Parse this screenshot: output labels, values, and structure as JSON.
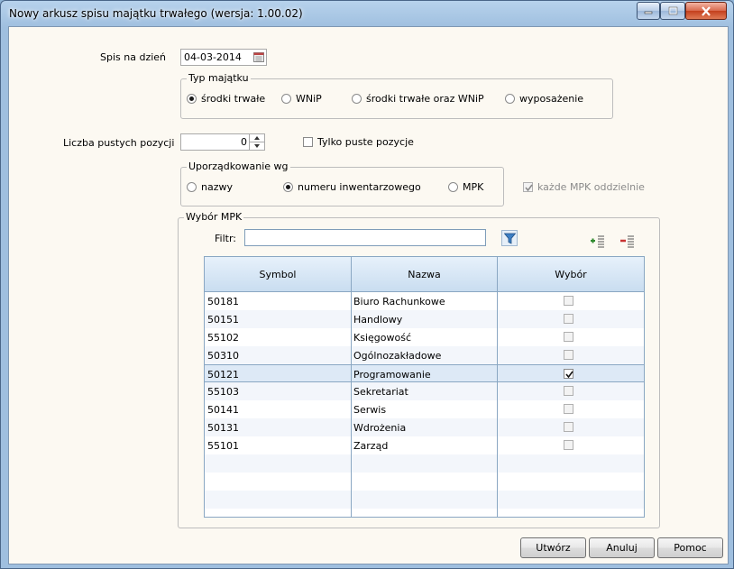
{
  "window": {
    "title": "Nowy arkusz spisu majątku trwałego (wersja: 1.00.02)",
    "controls": [
      "minimize-icon",
      "maximize-icon",
      "close-icon"
    ]
  },
  "form": {
    "date_label": "Spis na dzień",
    "date_value": "04-03-2014",
    "asset_type": {
      "legend": "Typ majątku",
      "options": [
        "środki trwałe",
        "WNiP",
        "środki trwałe oraz WNiP",
        "wyposażenie"
      ],
      "selected": "środki trwałe"
    },
    "empty_count_label": "Liczba pustych pozycji",
    "empty_count_value": "0",
    "only_empty_label": "Tylko puste pozycje",
    "only_empty_checked": false,
    "ordering": {
      "legend": "Uporządkowanie wg",
      "options": [
        "nazwy",
        "numeru inwentarzowego",
        "MPK"
      ],
      "selected": "numeru inwentarzowego"
    },
    "each_mpk_label": "każde MPK oddzielnie",
    "each_mpk_checked": true,
    "each_mpk_enabled": false
  },
  "mpk": {
    "legend": "Wybór MPK",
    "filter_label": "Filtr:",
    "filter_value": "",
    "columns": [
      "Symbol",
      "Nazwa",
      "Wybór"
    ],
    "rows": [
      {
        "symbol": "50181",
        "name": "Biuro Rachunkowe",
        "selected": false
      },
      {
        "symbol": "50151",
        "name": "Handlowy",
        "selected": false
      },
      {
        "symbol": "55102",
        "name": "Księgowość",
        "selected": false
      },
      {
        "symbol": "50310",
        "name": "Ogólnozakładowe",
        "selected": false
      },
      {
        "symbol": "50121",
        "name": "Programowanie",
        "selected": true
      },
      {
        "symbol": "55103",
        "name": "Sekretariat",
        "selected": false
      },
      {
        "symbol": "50141",
        "name": "Serwis",
        "selected": false
      },
      {
        "symbol": "50131",
        "name": "Wdrożenia",
        "selected": false
      },
      {
        "symbol": "55101",
        "name": "Zarząd",
        "selected": false
      }
    ],
    "icons": [
      "filter-icon",
      "select-all-icon",
      "deselect-all-icon"
    ]
  },
  "buttons": {
    "create": "Utwórz",
    "cancel": "Anuluj",
    "help": "Pomoc"
  },
  "colors": {
    "titlebar": "#9fbfdf",
    "client_bg": "#fcf9f2",
    "grid_header": "#c9ddf0",
    "grid_border": "#8aa7c3",
    "selected_row": "#dde9f6"
  }
}
